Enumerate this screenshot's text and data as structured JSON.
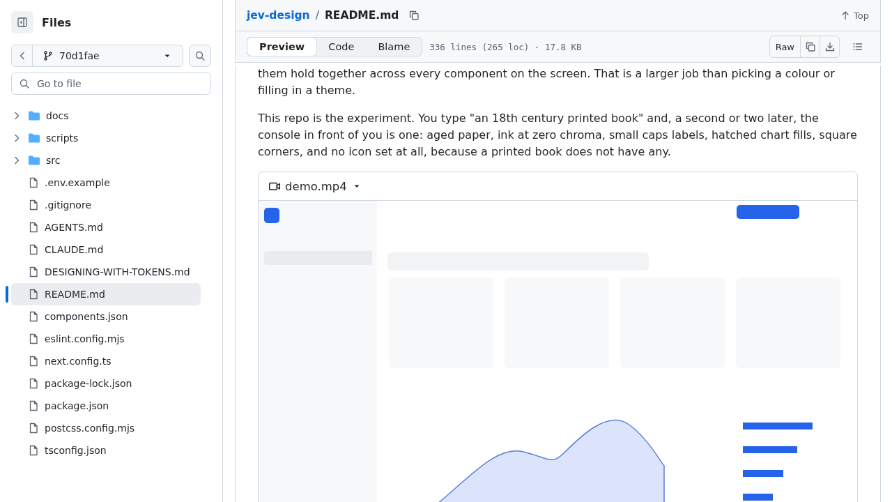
{
  "sidebar": {
    "title": "Files",
    "branch": "70d1fae",
    "search": {
      "placeholder": "Go to file"
    },
    "tree": [
      {
        "name": "docs",
        "kind": "folder",
        "expanded": false,
        "selected": false
      },
      {
        "name": "scripts",
        "kind": "folder",
        "expanded": false,
        "selected": false
      },
      {
        "name": "src",
        "kind": "folder",
        "expanded": false,
        "selected": false
      },
      {
        "name": ".env.example",
        "kind": "file",
        "selected": false
      },
      {
        "name": ".gitignore",
        "kind": "file",
        "selected": false
      },
      {
        "name": "AGENTS.md",
        "kind": "file",
        "selected": false
      },
      {
        "name": "CLAUDE.md",
        "kind": "file",
        "selected": false
      },
      {
        "name": "DESIGNING-WITH-TOKENS.md",
        "kind": "file",
        "selected": false
      },
      {
        "name": "README.md",
        "kind": "file",
        "selected": true
      },
      {
        "name": "components.json",
        "kind": "file",
        "selected": false
      },
      {
        "name": "eslint.config.mjs",
        "kind": "file",
        "selected": false
      },
      {
        "name": "next.config.ts",
        "kind": "file",
        "selected": false
      },
      {
        "name": "package-lock.json",
        "kind": "file",
        "selected": false
      },
      {
        "name": "package.json",
        "kind": "file",
        "selected": false
      },
      {
        "name": "postcss.config.mjs",
        "kind": "file",
        "selected": false
      },
      {
        "name": "tsconfig.json",
        "kind": "file",
        "selected": false
      }
    ]
  },
  "header": {
    "repo": "jev-design",
    "separator": "/",
    "file": "README.md",
    "top": "Top"
  },
  "toolbar": {
    "tabs": [
      {
        "label": "Preview",
        "selected": true
      },
      {
        "label": "Code",
        "selected": false
      },
      {
        "label": "Blame",
        "selected": false
      }
    ],
    "info": "336 lines (265 loc) · 17.8 KB",
    "raw": "Raw"
  },
  "content": {
    "paragraphs": [
      "them hold together across every component on the screen. That is a larger job than picking a colour or filling in a theme.",
      "This repo is the experiment. You type \"an 18th century printed book\" and, a second or two later, the console in front of you is one: aged paper, ink at zero chroma, small caps labels, hatched chart fills, square corners, and no icon set at all, because a printed book does not have any."
    ],
    "video": {
      "title": "demo.mp4",
      "kind": "picture"
    }
  }
}
